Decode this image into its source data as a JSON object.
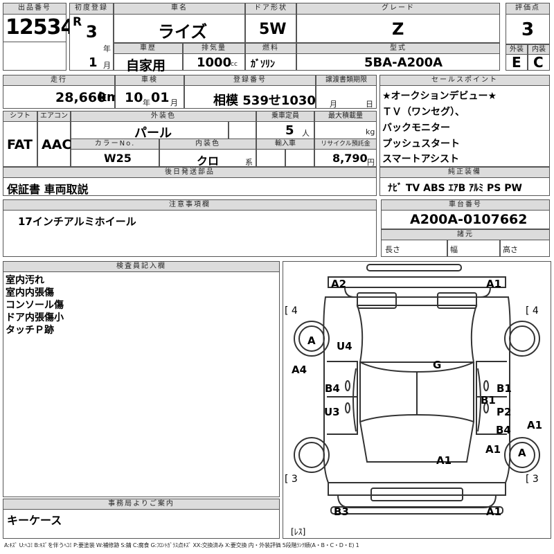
{
  "header": {
    "lot_number_label": "出品番号",
    "lot_number": "12534",
    "first_reg_label": "初度登録",
    "era": "R",
    "year": "3",
    "year_unit": "年",
    "month": "1",
    "month_unit": "月",
    "car_name_label": "車名",
    "car_name": "ライズ",
    "door_label": "ドア形状",
    "door": "5W",
    "grade_label": "グレード",
    "grade": "Z",
    "score_label": "評価点",
    "score": "3",
    "history_label": "車歴",
    "history": "自家用",
    "displacement_label": "排気量",
    "displacement": "1000",
    "displacement_unit": "cc",
    "fuel_label": "燃料",
    "fuel": "ｶﾞｿﾘﾝ",
    "model_label": "型式",
    "model": "5BA-A200A",
    "exterior_label": "外装",
    "exterior": "E",
    "interior_label": "内装",
    "interior": "C"
  },
  "row2": {
    "mileage_label": "走行",
    "mileage": "28,660",
    "mileage_unit": "km",
    "inspection_label": "車検",
    "insp_year": "10",
    "insp_year_unit": "年",
    "insp_month": "01",
    "insp_month_unit": "月",
    "reg_no_label": "登録番号",
    "reg_no": "相模 539せ1030",
    "transfer_label": "譲渡書類期限",
    "transfer_month_unit": "月",
    "transfer_day_unit": "日",
    "shift_label": "シフト",
    "shift": "FAT",
    "ac_label": "エアコン",
    "ac": "AAC",
    "ext_color_label": "外装色",
    "ext_color": "パール",
    "capacity_label": "乗車定員",
    "capacity": "5",
    "capacity_unit": "人",
    "max_load_label": "最大積載量",
    "max_load_unit": "kg",
    "color_no_label": "カラーNo.",
    "color_no": "W25",
    "int_color_label": "内装色",
    "int_color": "クロ",
    "int_color_unit": "系",
    "import_label": "輸入車",
    "recycle_label": "リサイクル預託金",
    "recycle": "8,790",
    "recycle_unit": "円"
  },
  "sales_points": {
    "label": "セールスポイント",
    "items": [
      "★オークションデビュー★",
      "ＴＶ（ワンセグ）、",
      "バックモニター",
      "プッシュスタート",
      "スマートアシスト"
    ]
  },
  "later_parts": {
    "label": "後日発送部品",
    "value": "保証書 車両取説"
  },
  "equipment": {
    "label": "純正装備",
    "value": "ﾅﾋﾞ TV ABS ｴｱB ｱﾙﾐ PS PW"
  },
  "notes": {
    "label": "注意事項欄",
    "value": "17インチアルミホイール"
  },
  "chassis": {
    "label": "車台番号",
    "value": "A200A-0107662"
  },
  "dims": {
    "label": "諸元",
    "length": "長さ",
    "width": "幅",
    "height": "高さ"
  },
  "inspector": {
    "label": "検査員記入欄",
    "lines": [
      "室内汚れ",
      "室内内張傷",
      "コンソール傷",
      "ドア内張傷小",
      "タッチＰ跡"
    ]
  },
  "office": {
    "label": "事務局よりご案内",
    "value": "キーケース"
  },
  "diagram": {
    "labels": {
      "a2": "A2",
      "a1_top": "A1",
      "tire_fl": "[ 4",
      "tire_fr": "[ 4",
      "a_left": "A",
      "u4": "U4",
      "a4": "A4",
      "g": "G",
      "b4_left": "B4",
      "b1_right": "B1",
      "b1_mid": "B1",
      "p2": "P2",
      "u3": "U3",
      "b4_right": "B4",
      "a1_right": "A1",
      "a1_mid": "A1",
      "a_right": "A",
      "a1_bottom": "A1",
      "tire_rl": "[ 3",
      "tire_rr": "[ 3",
      "b3": "B3",
      "a1_rear": "A1",
      "spare": "[ﾚｽ]"
    }
  },
  "legend": "A:ｷｽﾞ U:ﾍｺﾐ B:ｷｽﾞを伴うﾍｺﾐ P:要塗装 W:補修跡 S:錆 C:腐食 G:ﾌﾛﾝﾄｶﾞﾗｽ点ｷｽﾞ XX:交換済み X:要交換 内・外装評価 5段階ﾗﾝｸ順(A・B・C・D・E) 1"
}
